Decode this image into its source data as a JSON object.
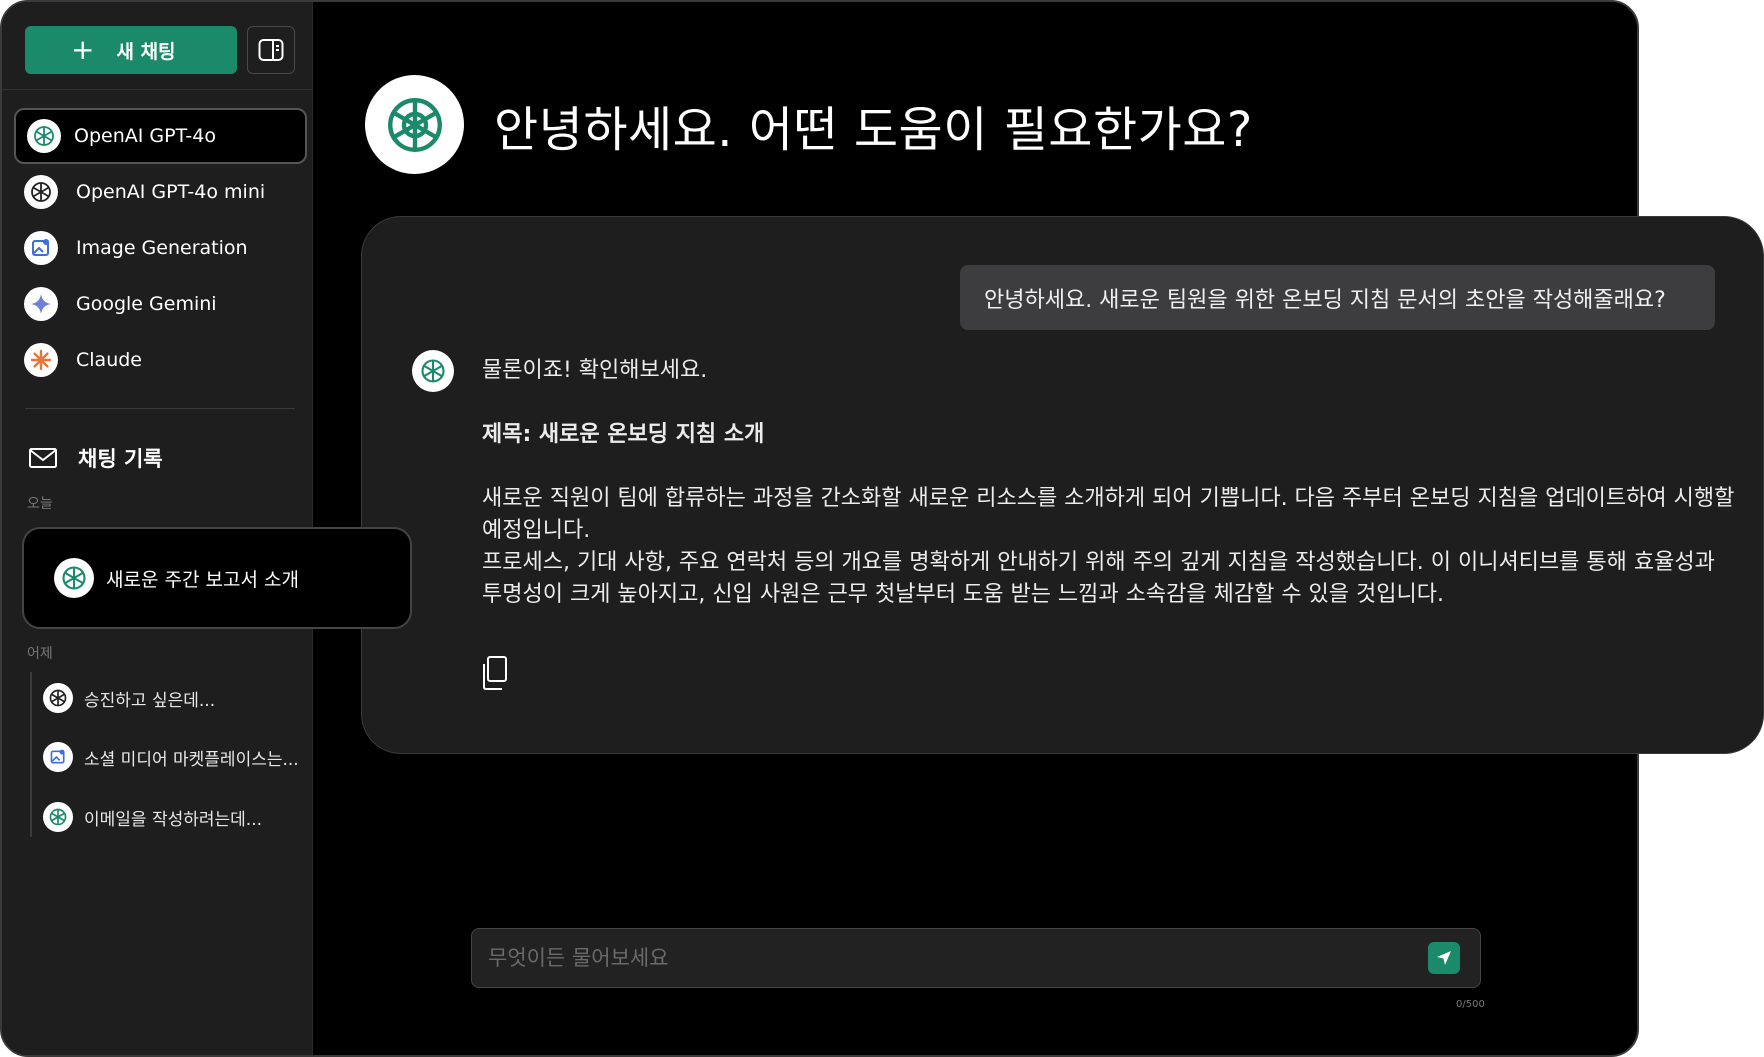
{
  "sidebar": {
    "new_chat_label": "새 채팅",
    "models": [
      {
        "label": "OpenAI GPT-4o",
        "icon": "openai-icon"
      },
      {
        "label": "OpenAI GPT-4o mini",
        "icon": "openai-icon"
      },
      {
        "label": "Image Generation",
        "icon": "image-generation-icon"
      },
      {
        "label": "Google Gemini",
        "icon": "gemini-icon"
      },
      {
        "label": "Claude",
        "icon": "claude-icon"
      }
    ],
    "history_title": "채팅 기록",
    "today_label": "오늘",
    "yesterday_label": "어제",
    "today_items": [
      {
        "label": "새로운 주간 보고서 소개",
        "icon": "openai-icon"
      }
    ],
    "yesterday_items": [
      {
        "label": "승진하고 싶은데...",
        "icon": "openai-icon"
      },
      {
        "label": "소셜 미디어 마켓플레이스는...",
        "icon": "image-generation-icon"
      },
      {
        "label": "이메일을 작성하려는데...",
        "icon": "openai-icon"
      }
    ]
  },
  "main": {
    "greeting": "안녕하세요. 어떤 도움이 필요한가요?",
    "conversation": {
      "user_message": "안녕하세요. 새로운 팀원을 위한 온보딩 지침 문서의 초안을 작성해줄래요?",
      "assistant_intro": "물론이죠! 확인해보세요.",
      "assistant_title": "제목: 새로운 온보딩 지침 소개",
      "assistant_para1": "새로운 직원이 팀에 합류하는 과정을 간소화할 새로운 리소스를 소개하게 되어 기쁩니다. 다음 주부터 온보딩 지침을 업데이트하여 시행할 예정입니다.",
      "assistant_para2": "프로세스, 기대 사항, 주요 연락처 등의 개요를 명확하게 안내하기 위해 주의 깊게 지침을 작성했습니다. 이 이니셔티브를 통해 효율성과 투명성이 크게 높아지고, 신입 사원은 근무 첫날부터 도움 받는 느낌과 소속감을 체감할 수 있을 것입니다."
    },
    "composer": {
      "placeholder": "무엇이든 물어보세요",
      "counter": "0/500"
    }
  },
  "colors": {
    "accent": "#1b8a6b",
    "background": "#000000",
    "sidebar": "#1e1e1e",
    "card": "#1e1e1e",
    "user_bubble": "#3d3d3f"
  }
}
